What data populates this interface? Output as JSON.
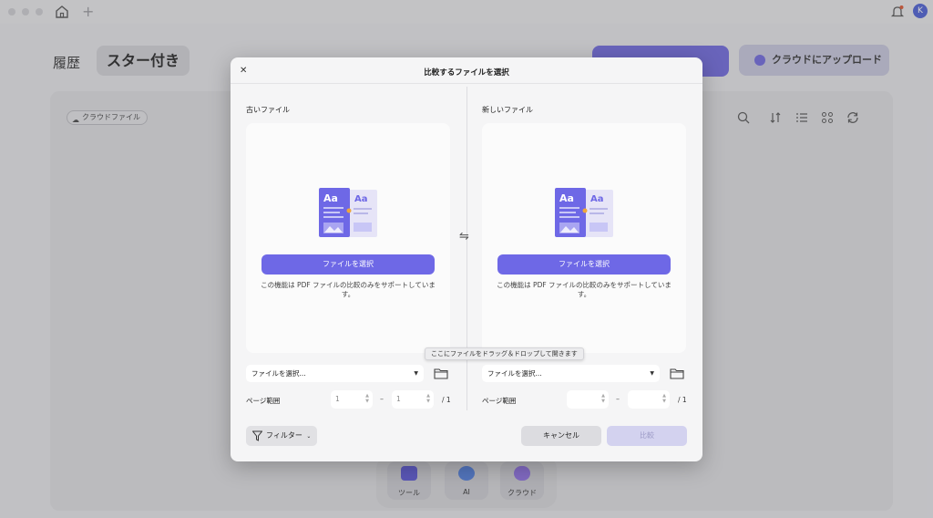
{
  "titlebar": {
    "avatar_initial": "K"
  },
  "background": {
    "tab_history": "履歴",
    "tab_starred": "スター付き",
    "upload_button": "クラウドにアップロード",
    "cloud_files_chip": "クラウドファイル",
    "dock": [
      {
        "label": "ツール",
        "icon": "toolbox-icon"
      },
      {
        "label": "AI",
        "icon": "ai-icon"
      },
      {
        "label": "クラウド",
        "icon": "cloud-icon"
      }
    ]
  },
  "dialog": {
    "title": "比較するファイルを選択",
    "old_file": {
      "label": "古いファイル",
      "pick_button": "ファイルを選択",
      "note": "この機能は PDF ファイルの比較のみをサポートしています。",
      "select_value": "ファイルを選択...",
      "page_range_label": "ページ範囲",
      "page_from": "1",
      "page_to": "1",
      "total": "/ 1"
    },
    "new_file": {
      "label": "新しいファイル",
      "pick_button": "ファイルを選択",
      "note": "この機能は PDF ファイルの比較のみをサポートしています。",
      "select_value": "ファイルを選択...",
      "page_range_label": "ページ範囲",
      "page_from": "",
      "page_to": "",
      "total": "/ 1"
    },
    "drag_tip": "ここにファイルをドラッグ＆ドロップして開きます",
    "filter_button": "フィルター",
    "cancel_button": "キャンセル",
    "compare_button": "比較"
  },
  "colors": {
    "accent": "#6e68e6",
    "disabled_accent": "#d3d2ef"
  }
}
